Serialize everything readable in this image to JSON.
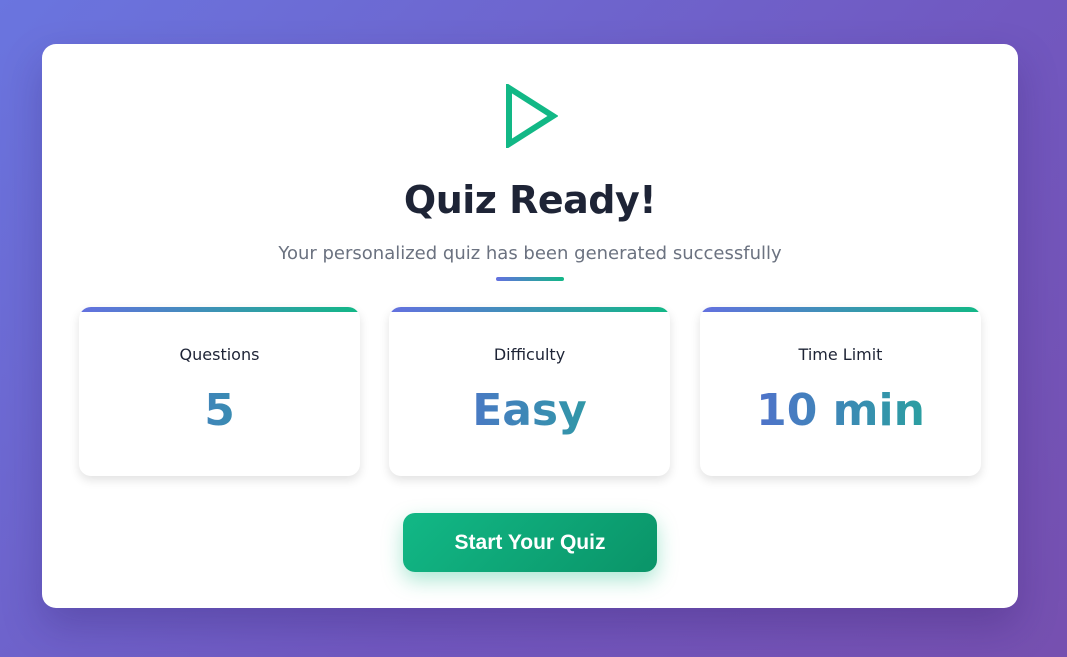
{
  "icon": {
    "name": "play-icon",
    "color": "#12b886"
  },
  "title": "Quiz Ready!",
  "subtitle": "Your personalized quiz has been generated successfully",
  "stats": [
    {
      "label": "Questions",
      "value": "5"
    },
    {
      "label": "Difficulty",
      "value": "Easy"
    },
    {
      "label": "Time Limit",
      "value": "10 min"
    }
  ],
  "start_button": {
    "label": "Start Your Quiz"
  },
  "colors": {
    "accent_start": "#6470e0",
    "accent_end": "#12b886",
    "button": "#12b886",
    "title": "#1e2436",
    "subtitle": "#6b7280"
  }
}
